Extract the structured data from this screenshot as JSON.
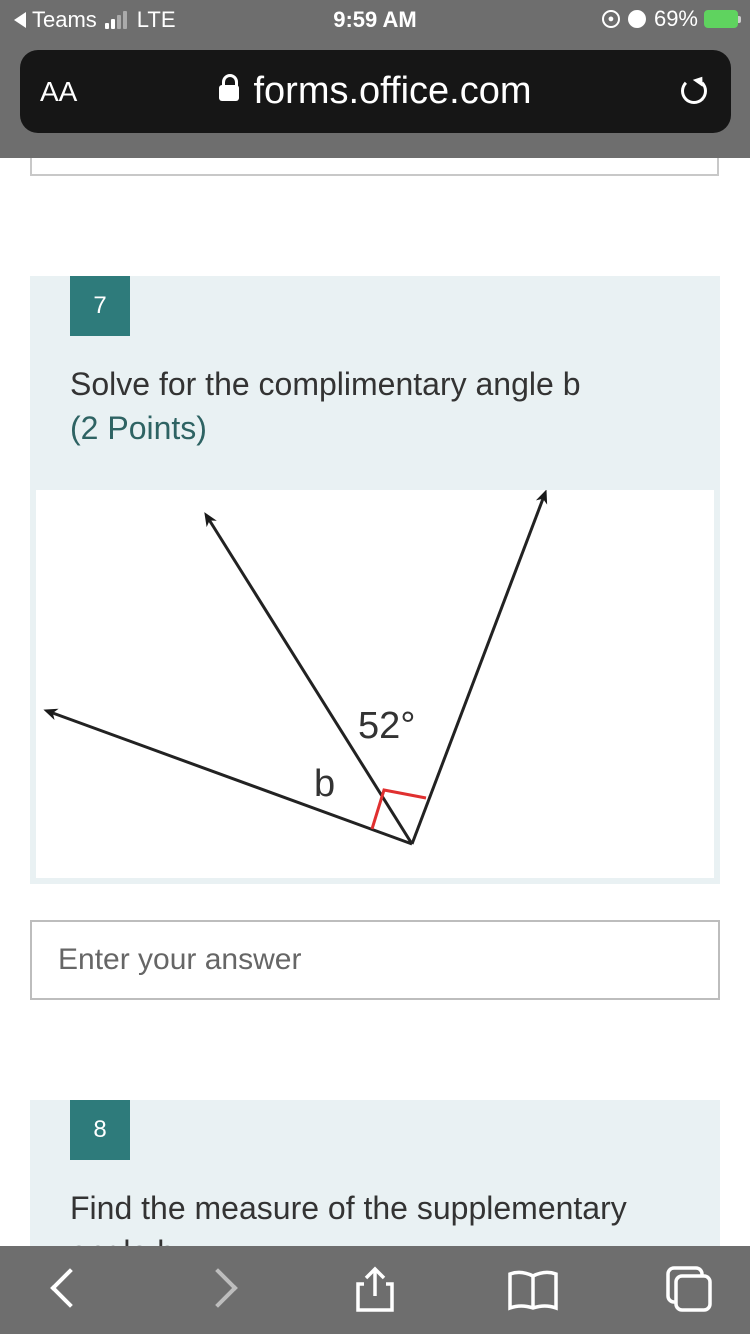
{
  "status_bar": {
    "back_app": "Teams",
    "network": "LTE",
    "time": "9:59 AM",
    "battery_percent": "69%"
  },
  "browser": {
    "text_size_label": "AA",
    "url": "forms.office.com"
  },
  "questions": [
    {
      "number": "7",
      "text": "Solve for the complimentary angle b",
      "points": "(2 Points)",
      "figure": {
        "angle_label": "52°",
        "unknown_label": "b"
      },
      "answer_placeholder": "Enter your answer"
    },
    {
      "number": "8",
      "text": "Find the measure of the supplementary angle b"
    }
  ],
  "icons": {
    "back": "chevron-left-icon",
    "forward": "chevron-right-icon",
    "share": "share-icon",
    "bookmarks": "book-icon",
    "tabs": "tabs-icon"
  },
  "colors": {
    "accent": "#2e7b7b",
    "card": "#e9f1f3",
    "right_angle_mark": "#e03030"
  }
}
